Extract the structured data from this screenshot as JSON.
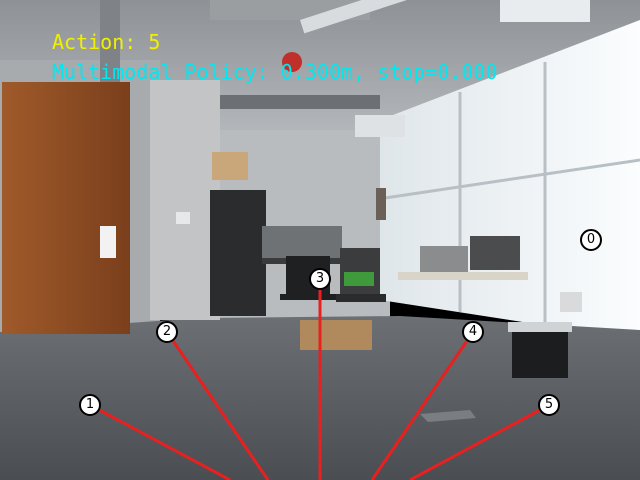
{
  "hud": {
    "action_text": "Action: 5",
    "policy_text": "Multimodal Policy: 0.300m, stop=0.000",
    "action_color": "#f0f000",
    "policy_color": "#00e8f0"
  },
  "trajectory_markers": [
    {
      "label": "0"
    },
    {
      "label": "1"
    },
    {
      "label": "2"
    },
    {
      "label": "3"
    },
    {
      "label": "4"
    },
    {
      "label": "5"
    }
  ],
  "trajectory_color": "#e82020"
}
